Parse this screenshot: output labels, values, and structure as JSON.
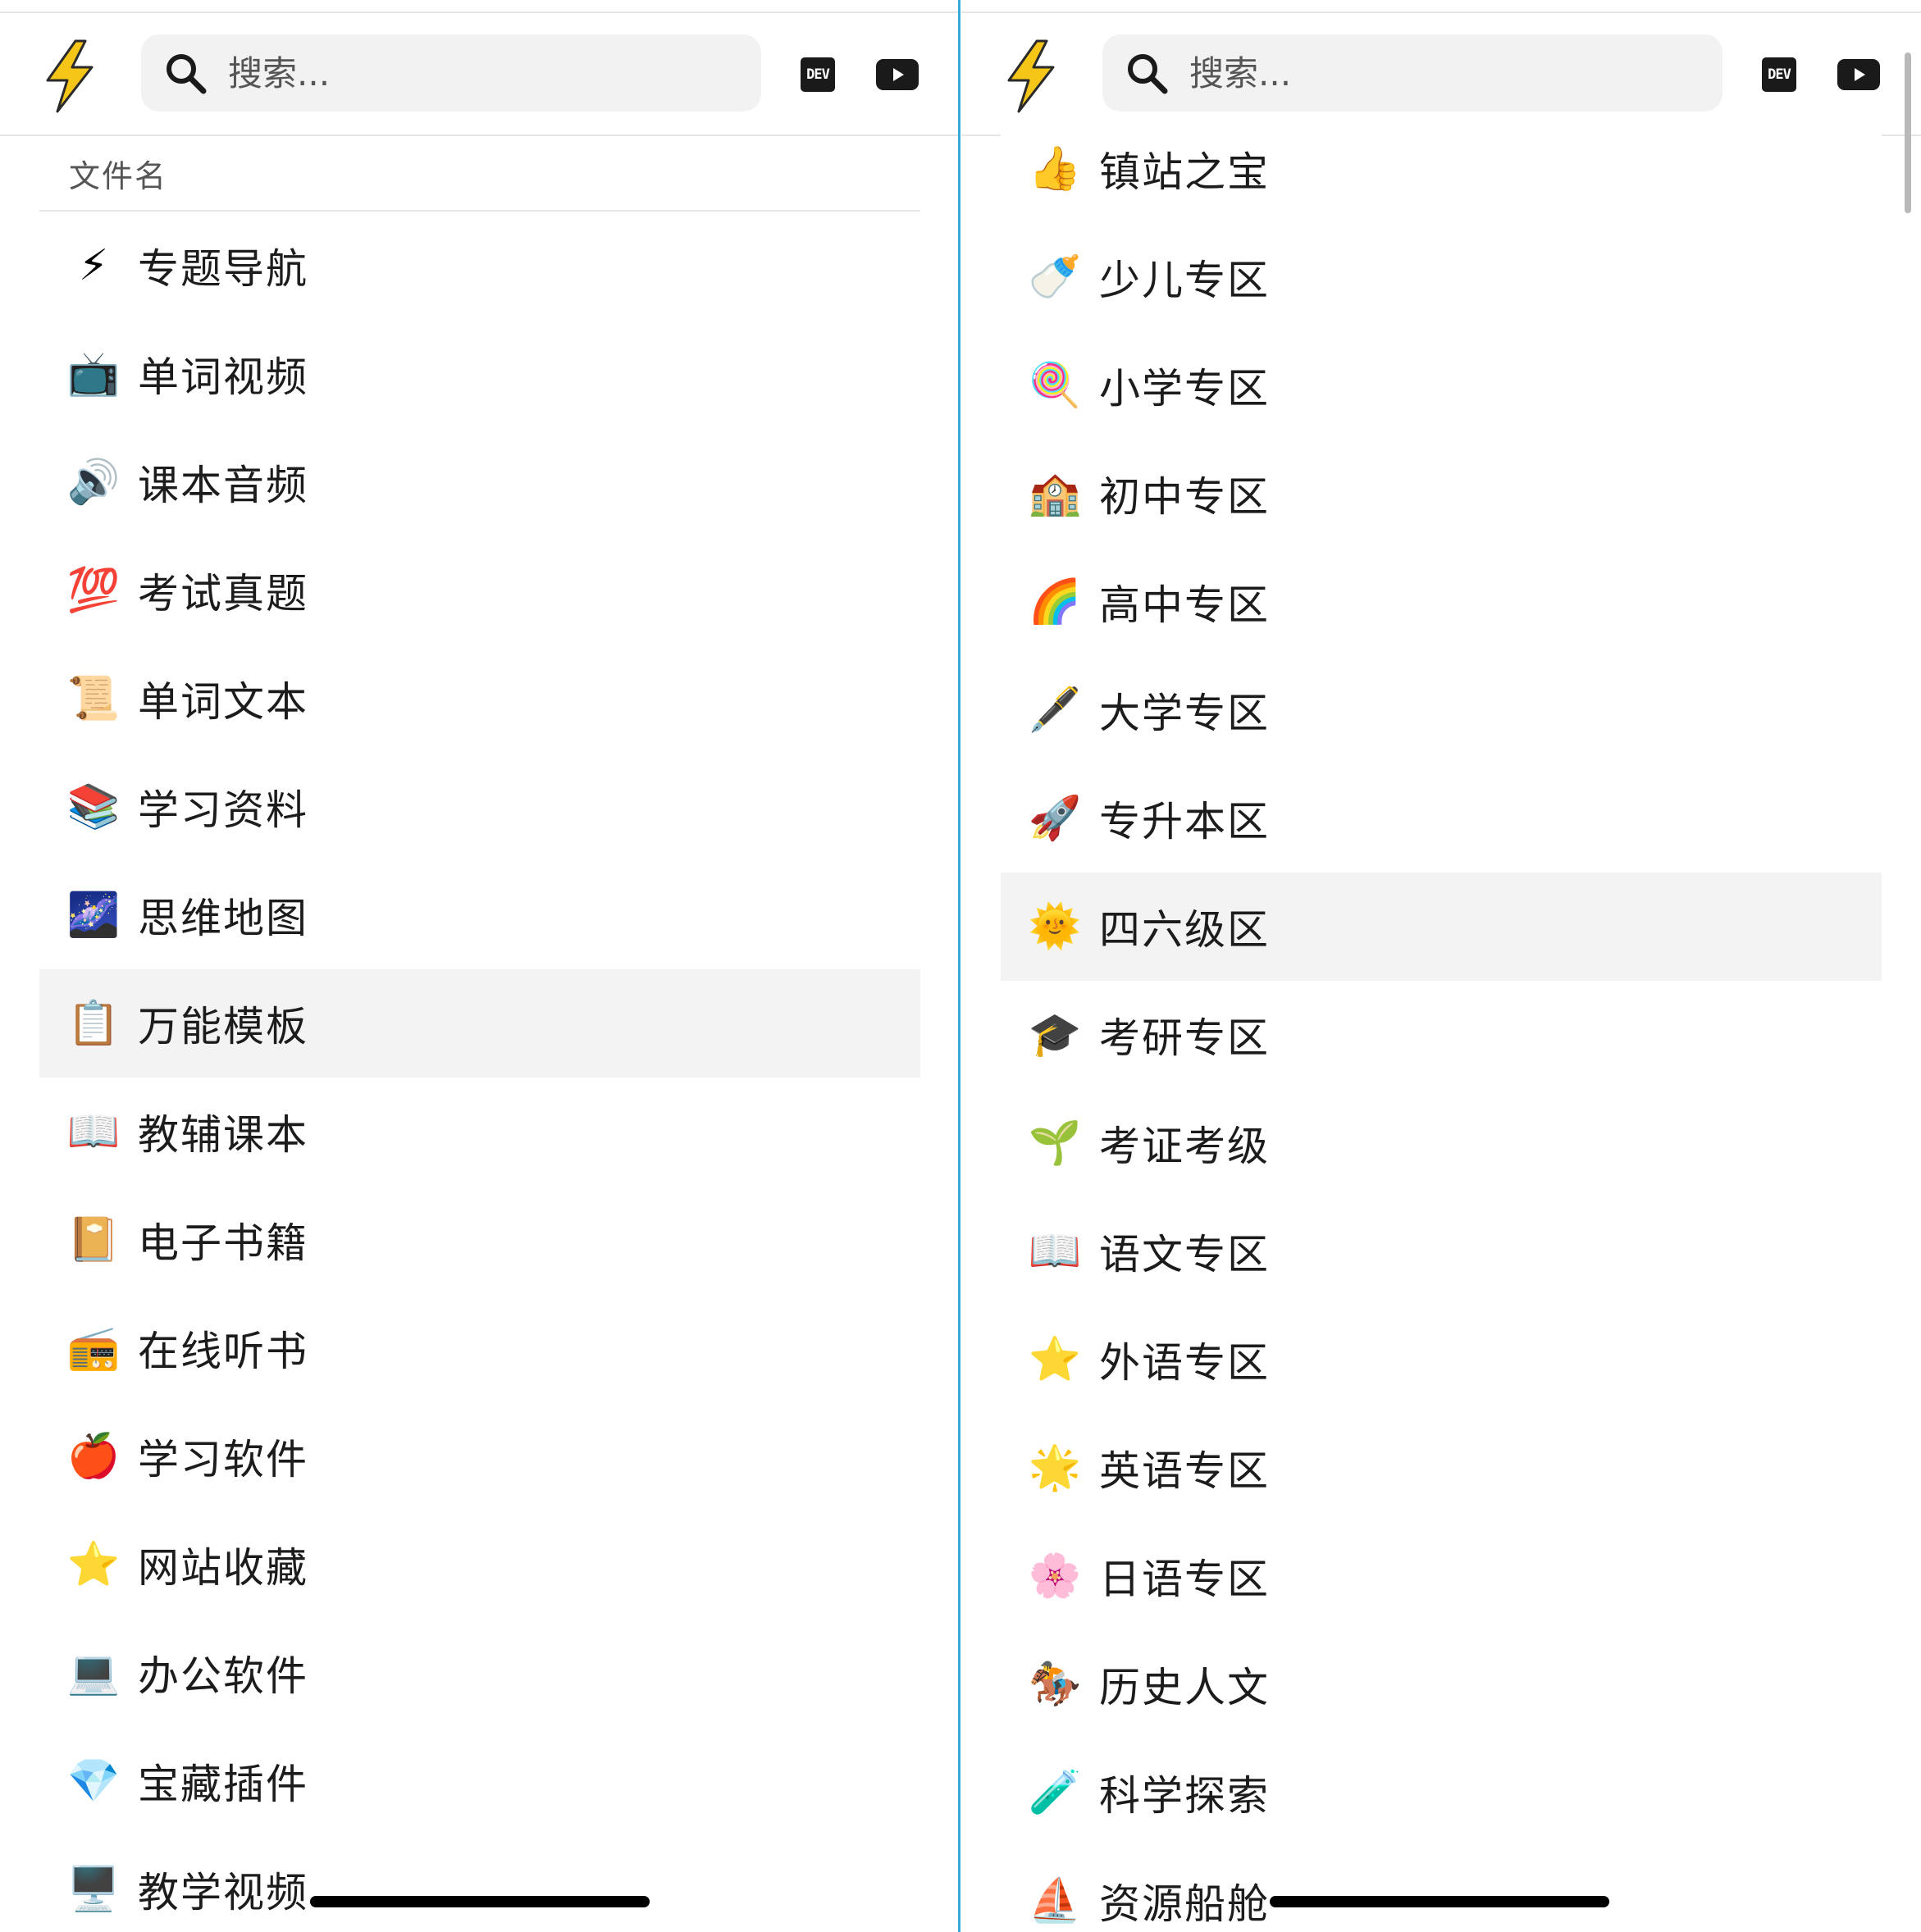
{
  "colors": {
    "divider": "#3aa7d9",
    "selected_row": "#f3f3f3",
    "search_bg": "#f2f2f2",
    "logo_yellow": "#f5c518"
  },
  "left": {
    "search_placeholder": "搜索...",
    "dev_label": "DEV",
    "list_header": "文件名",
    "items": [
      {
        "emoji": "⚡",
        "icon": "lightning-icon",
        "label": "专题导航"
      },
      {
        "emoji": "📺",
        "icon": "television-icon",
        "label": "单词视频"
      },
      {
        "emoji": "🔊",
        "icon": "speaker-icon",
        "label": "课本音频"
      },
      {
        "emoji": "💯",
        "icon": "hundred-points-icon",
        "label": "考试真题"
      },
      {
        "emoji": "📜",
        "icon": "scroll-icon",
        "label": "单词文本"
      },
      {
        "emoji": "📚",
        "icon": "books-icon",
        "label": "学习资料"
      },
      {
        "emoji": "🌌",
        "icon": "milky-way-icon",
        "label": "思维地图"
      },
      {
        "emoji": "📋",
        "icon": "clipboard-icon",
        "label": "万能模板"
      },
      {
        "emoji": "📖",
        "icon": "open-book-icon",
        "label": "教辅课本"
      },
      {
        "emoji": "📔",
        "icon": "notebook-icon",
        "label": "电子书籍"
      },
      {
        "emoji": "📻",
        "icon": "radio-icon",
        "label": "在线听书"
      },
      {
        "emoji": "🍎",
        "icon": "apple-icon",
        "label": "学习软件"
      },
      {
        "emoji": "⭐",
        "icon": "star-icon",
        "label": "网站收藏"
      },
      {
        "emoji": "💻",
        "icon": "laptop-icon",
        "label": "办公软件"
      },
      {
        "emoji": "💎",
        "icon": "gem-icon",
        "label": "宝藏插件"
      },
      {
        "emoji": "🖥️",
        "icon": "desktop-computer-icon",
        "label": "教学视频"
      }
    ]
  },
  "right": {
    "search_placeholder": "搜索...",
    "dev_label": "DEV",
    "items": [
      {
        "emoji": "👍",
        "icon": "thumbs-up-icon",
        "label": "镇站之宝"
      },
      {
        "emoji": "🍼",
        "icon": "baby-bottle-icon",
        "label": "少儿专区"
      },
      {
        "emoji": "🍭",
        "icon": "lollipop-icon",
        "label": "小学专区"
      },
      {
        "emoji": "🏫",
        "icon": "school-icon",
        "label": "初中专区"
      },
      {
        "emoji": "🌈",
        "icon": "rainbow-icon",
        "label": "高中专区"
      },
      {
        "emoji": "🖋️",
        "icon": "fountain-pen-icon",
        "label": "大学专区"
      },
      {
        "emoji": "🚀",
        "icon": "rocket-icon",
        "label": "专升本区"
      },
      {
        "emoji": "🌞",
        "icon": "sun-face-icon",
        "label": "四六级区"
      },
      {
        "emoji": "🎓",
        "icon": "graduation-cap-icon",
        "label": "考研专区"
      },
      {
        "emoji": "🌱",
        "icon": "seedling-icon",
        "label": "考证考级"
      },
      {
        "emoji": "📖",
        "icon": "open-book-icon",
        "label": "语文专区"
      },
      {
        "emoji": "⭐",
        "icon": "star-icon",
        "label": "外语专区"
      },
      {
        "emoji": "🌟",
        "icon": "glowing-star-icon",
        "label": "英语专区"
      },
      {
        "emoji": "🌸",
        "icon": "cherry-blossom-icon",
        "label": "日语专区"
      },
      {
        "emoji": "🏇",
        "icon": "horse-racing-icon",
        "label": "历史人文"
      },
      {
        "emoji": "🧪",
        "icon": "test-tube-icon",
        "label": "科学探索"
      },
      {
        "emoji": "⛵",
        "icon": "sailboat-icon",
        "label": "资源船舱"
      }
    ]
  }
}
